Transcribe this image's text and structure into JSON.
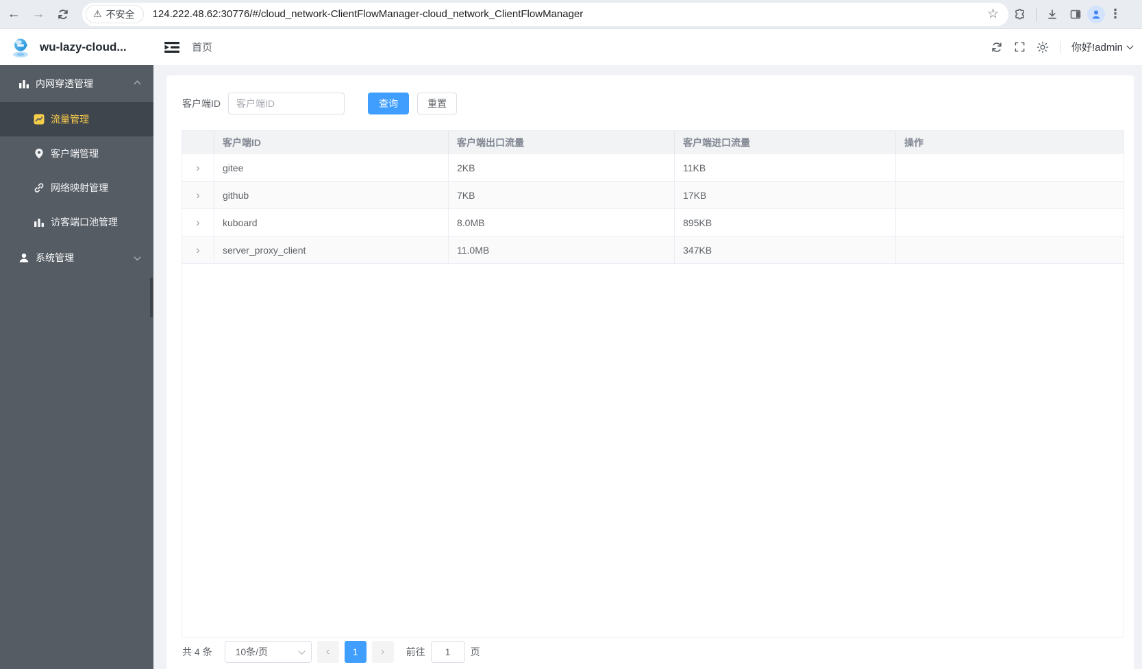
{
  "browser": {
    "security_label": "不安全",
    "url": "124.222.48.62:30776/#/cloud_network-ClientFlowManager-cloud_network_ClientFlowManager"
  },
  "header": {
    "app_title": "wu-lazy-cloud...",
    "breadcrumb": "首页",
    "greeting": "你好!admin"
  },
  "sidebar": {
    "group1": "内网穿透管理",
    "items": [
      {
        "label": "流量管理"
      },
      {
        "label": "客户端管理"
      },
      {
        "label": "网络映射管理"
      },
      {
        "label": "访客端口池管理"
      }
    ],
    "group2": "系统管理"
  },
  "search": {
    "label": "客户端ID",
    "placeholder": "客户端ID",
    "query": "查询",
    "reset": "重置"
  },
  "table": {
    "headers": [
      "客户端ID",
      "客户端出口流量",
      "客户端进口流量",
      "操作"
    ],
    "rows": [
      {
        "id": "gitee",
        "out": "2KB",
        "in": "11KB"
      },
      {
        "id": "github",
        "out": "7KB",
        "in": "17KB"
      },
      {
        "id": "kuboard",
        "out": "8.0MB",
        "in": "895KB"
      },
      {
        "id": "server_proxy_client",
        "out": "11.0MB",
        "in": "347KB"
      }
    ]
  },
  "pagination": {
    "total": "共 4 条",
    "page_size": "10条/页",
    "current": "1",
    "goto_label": "前往",
    "goto_value": "1",
    "unit": "页"
  },
  "icons": {
    "back": "←",
    "forward": "→",
    "star": "☆",
    "warning": "⚠",
    "menu_dots": "⋮",
    "expand_row": "›",
    "prev_page": "‹",
    "next_page": "›"
  },
  "colors": {
    "accent": "#409eff",
    "sidebar_bg": "#555c64",
    "active_menu_text": "#ffd04b",
    "page_bg": "#f0f2f5"
  }
}
